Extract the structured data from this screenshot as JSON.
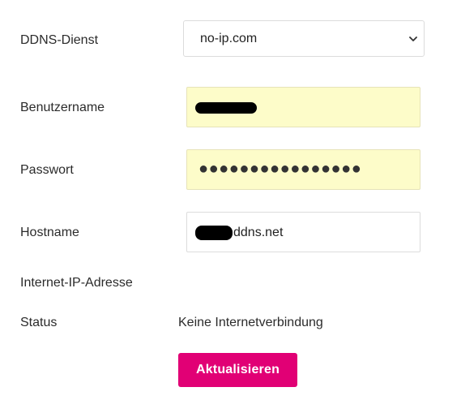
{
  "form": {
    "ddns": {
      "label": "DDNS-Dienst",
      "value": "no-ip.com",
      "icon": "chevron-down-icon"
    },
    "username": {
      "label": "Benutzername",
      "value": ""
    },
    "password": {
      "label": "Passwort",
      "value": "●●●●●●●●●●●●●●●●"
    },
    "hostname": {
      "label": "Hostname",
      "value": "ddns.net"
    },
    "internet_ip": {
      "label": "Internet-IP-Adresse",
      "value": ""
    },
    "status": {
      "label": "Status",
      "value": "Keine Internetverbindung"
    },
    "update_button": {
      "label": "Aktualisieren"
    }
  },
  "colors": {
    "accent": "#e10075",
    "autofill_bg": "#fdfcc9"
  }
}
